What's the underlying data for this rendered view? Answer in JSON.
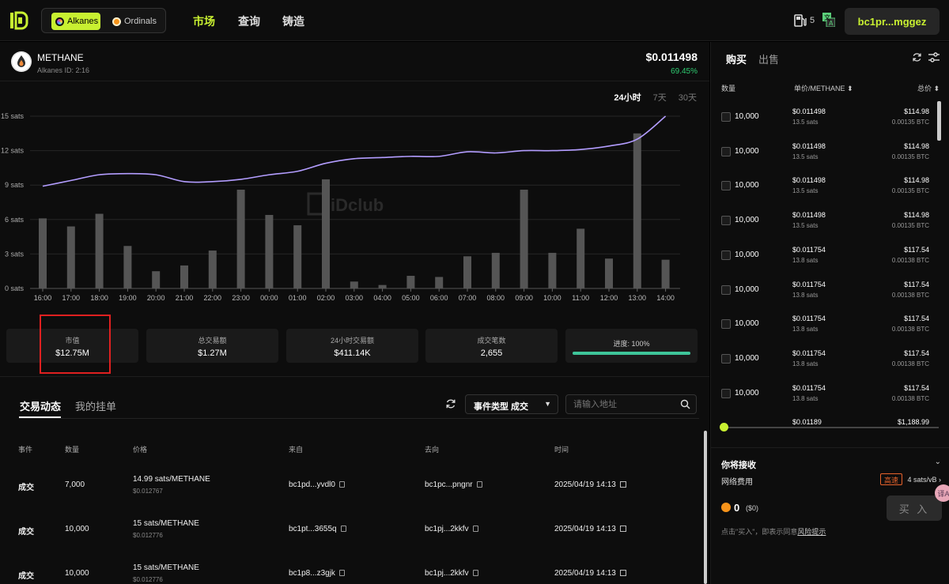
{
  "nav": {
    "protocols": [
      {
        "label": "Alkanes",
        "active": true
      },
      {
        "label": "Ordinals",
        "active": false
      }
    ],
    "menu": [
      "市场",
      "查询",
      "铸造"
    ],
    "fuel_count": "5",
    "wallet_label": "bc1pr...mggez",
    "accent_color": "#c8f031"
  },
  "token": {
    "name": "METHANE",
    "id_label": "Alkanes ID: 2:16",
    "price": "$0.011498",
    "change": "69.45%"
  },
  "range_tabs": [
    "24小时",
    "7天",
    "30天"
  ],
  "watermark": "iDclub",
  "chart_data": {
    "type": "bar+line",
    "categories": [
      "16:00",
      "17:00",
      "18:00",
      "19:00",
      "20:00",
      "21:00",
      "22:00",
      "23:00",
      "00:00",
      "01:00",
      "02:00",
      "03:00",
      "04:00",
      "05:00",
      "06:00",
      "07:00",
      "08:00",
      "09:00",
      "10:00",
      "11:00",
      "12:00",
      "13:00",
      "14:00"
    ],
    "y_ticks": [
      "0 sats",
      "3 sats",
      "6 sats",
      "9 sats",
      "12 sats",
      "15 sats"
    ],
    "ylim": [
      0,
      15
    ],
    "series": [
      {
        "type": "bar",
        "values": [
          6.1,
          5.4,
          6.5,
          3.7,
          1.5,
          2.0,
          3.3,
          8.6,
          6.4,
          5.5,
          9.5,
          0.6,
          0.3,
          1.1,
          1.0,
          2.8,
          3.1,
          8.6,
          3.1,
          5.2,
          2.6,
          13.5,
          2.5
        ]
      },
      {
        "type": "line",
        "values": [
          8.9,
          9.4,
          9.9,
          10.0,
          9.9,
          9.3,
          9.3,
          9.5,
          9.9,
          10.2,
          10.9,
          11.3,
          11.4,
          11.5,
          11.5,
          11.9,
          11.8,
          12.0,
          12.0,
          12.1,
          12.4,
          13.0,
          15.0
        ]
      }
    ]
  },
  "stats": [
    {
      "label": "市值",
      "value": "$12.75M"
    },
    {
      "label": "总交易额",
      "value": "$1.27M"
    },
    {
      "label": "24小时交易额",
      "value": "$411.14K"
    },
    {
      "label": "成交笔数",
      "value": "2,655"
    }
  ],
  "progress": {
    "label": "进度: 100%",
    "fraction": 1.0
  },
  "activity": {
    "tabs": [
      "交易动态",
      "我的挂单"
    ],
    "event_type": "事件类型 成交",
    "address_placeholder": "请输入地址",
    "headers": [
      "事件",
      "数量",
      "价格",
      "来自",
      "去向",
      "时间"
    ],
    "rows": [
      {
        "event": "成交",
        "qty": "7,000",
        "price": "14.99 sats/METHANE",
        "usd": "$0.012767",
        "from": "bc1pd...yvdl0",
        "to": "bc1pc...pngnr",
        "time": "2025/04/19 14:13"
      },
      {
        "event": "成交",
        "qty": "10,000",
        "price": "15 sats/METHANE",
        "usd": "$0.012776",
        "from": "bc1pt...3655q",
        "to": "bc1pj...2kkfv",
        "time": "2025/04/19 14:13"
      },
      {
        "event": "成交",
        "qty": "10,000",
        "price": "15 sats/METHANE",
        "usd": "$0.012776",
        "from": "bc1p8...z3gjk",
        "to": "bc1pj...2kkfv",
        "time": "2025/04/19 14:13"
      }
    ]
  },
  "orderbook": {
    "tabs": [
      "购买",
      "出售"
    ],
    "headers": [
      "数量",
      "单价/METHANE ⬍",
      "总价 ⬍"
    ],
    "orders": [
      {
        "qty": "10,000",
        "price": "$0.011498",
        "sats": "13.5 sats",
        "total": "$114.98",
        "btc": "0.00135 BTC"
      },
      {
        "qty": "10,000",
        "price": "$0.011498",
        "sats": "13.5 sats",
        "total": "$114.98",
        "btc": "0.00135 BTC"
      },
      {
        "qty": "10,000",
        "price": "$0.011498",
        "sats": "13.5 sats",
        "total": "$114.98",
        "btc": "0.00135 BTC"
      },
      {
        "qty": "10,000",
        "price": "$0.011498",
        "sats": "13.5 sats",
        "total": "$114.98",
        "btc": "0.00135 BTC"
      },
      {
        "qty": "10,000",
        "price": "$0.011754",
        "sats": "13.8 sats",
        "total": "$117.54",
        "btc": "0.00138 BTC"
      },
      {
        "qty": "10,000",
        "price": "$0.011754",
        "sats": "13.8 sats",
        "total": "$117.54",
        "btc": "0.00138 BTC"
      },
      {
        "qty": "10,000",
        "price": "$0.011754",
        "sats": "13.8 sats",
        "total": "$117.54",
        "btc": "0.00138 BTC"
      },
      {
        "qty": "10,000",
        "price": "$0.011754",
        "sats": "13.8 sats",
        "total": "$117.54",
        "btc": "0.00138 BTC"
      },
      {
        "qty": "10,000",
        "price": "$0.011754",
        "sats": "13.8 sats",
        "total": "$117.54",
        "btc": "0.00138 BTC"
      },
      {
        "qty": "",
        "price": "$0.01189",
        "sats": "",
        "total": "$1,188.99",
        "btc": ""
      }
    ],
    "slider_fraction": 0.0,
    "receive_label": "你将接收",
    "fee_label": "网络费用",
    "fee_speed": "高速",
    "fee_rate": "4 sats/vB",
    "pay_amount": "0",
    "pay_usd": "($0)",
    "buy_label": "买 入",
    "terms_prefix": "点击\"买入\"，即表示同意",
    "terms_link": "风险提示"
  },
  "translate_badge": "译A"
}
